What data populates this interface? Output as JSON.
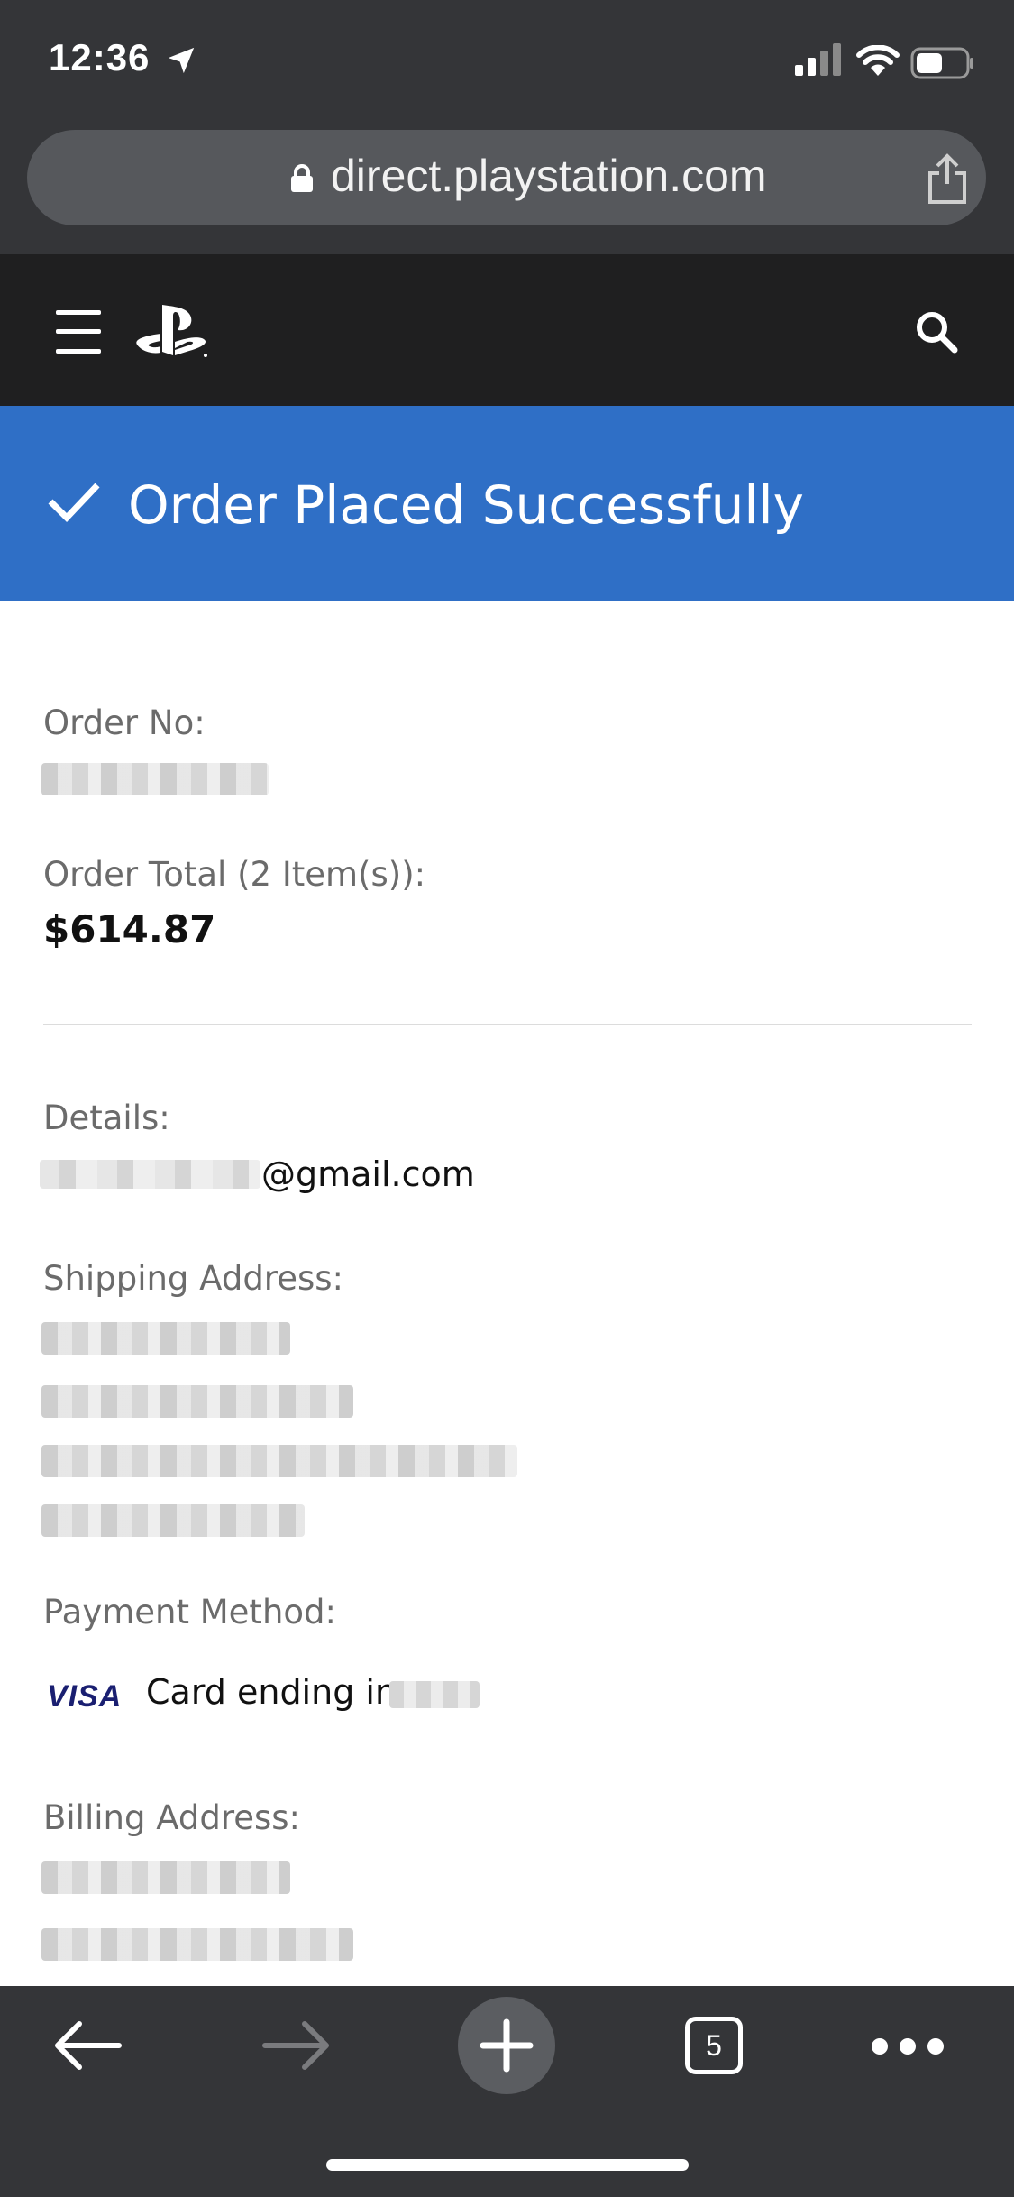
{
  "status_bar": {
    "time": "12:36"
  },
  "browser": {
    "url": "direct.playstation.com",
    "tab_count": "5"
  },
  "banner": {
    "title": "Order Placed Successfully"
  },
  "order": {
    "number_label": "Order No:",
    "total_label": "Order Total  (2 Item(s)):",
    "total_value": "$614.87"
  },
  "details": {
    "label": "Details:",
    "email_domain": "@gmail.com"
  },
  "shipping": {
    "label": "Shipping Address:"
  },
  "payment": {
    "label": "Payment Method:",
    "card_brand": "VISA",
    "card_text": "Card ending in"
  },
  "billing": {
    "label": "Billing Address:"
  },
  "colors": {
    "banner_blue": "#2f6fc6",
    "nav_dark": "#1f1f20",
    "browser_chrome": "#343538",
    "visa_blue": "#1a1f71"
  },
  "icons": [
    "location-arrow-icon",
    "signal-icon",
    "wifi-icon",
    "battery-icon",
    "lock-icon",
    "share-icon",
    "menu-icon",
    "playstation-logo-icon",
    "search-icon",
    "check-icon",
    "back-icon",
    "forward-icon",
    "new-tab-icon",
    "tabs-icon",
    "more-icon"
  ]
}
